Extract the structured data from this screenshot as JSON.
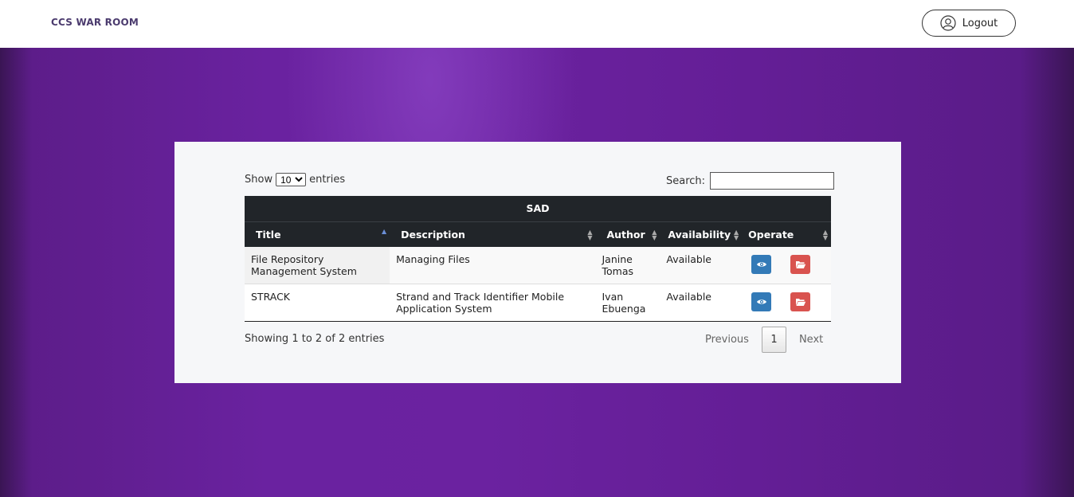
{
  "nav": {
    "brand": "CCS WAR ROOM",
    "logout_label": "Logout"
  },
  "table_controls": {
    "show_label": "Show",
    "entries_label": "entries",
    "page_size": "10",
    "search_label": "Search:",
    "search_value": ""
  },
  "table": {
    "group_header": "SAD",
    "columns": [
      "Title",
      "Description",
      "Author",
      "Availability",
      "Operate"
    ],
    "rows": [
      {
        "title": "File Repository Management System",
        "description": "Managing Files",
        "author": "Janine Tomas",
        "availability": "Available"
      },
      {
        "title": "STRACK",
        "description": "Strand and Track Identifier Mobile Application System",
        "author": "Ivan Ebuenga",
        "availability": "Available"
      }
    ]
  },
  "footer": {
    "info": "Showing 1 to 2 of 2 entries",
    "previous": "Previous",
    "current_page": "1",
    "next": "Next"
  },
  "colors": {
    "view_button": "#337ab7",
    "folder_button": "#d9534f",
    "header_bg": "#212529",
    "hero_purple": "#6a22a0"
  },
  "icons": {
    "logout": "user-circle-icon",
    "view": "eye-icon",
    "open": "folder-open-icon"
  }
}
